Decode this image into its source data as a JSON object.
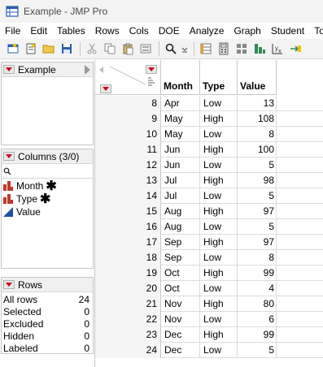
{
  "window": {
    "title": "Example - JMP Pro"
  },
  "menu": [
    "File",
    "Edit",
    "Tables",
    "Rows",
    "Cols",
    "DOE",
    "Analyze",
    "Graph",
    "Student",
    "To"
  ],
  "left": {
    "table_panel": {
      "title": "Example"
    },
    "columns_panel": {
      "title": "Columns (3/0)",
      "items": [
        {
          "label": "Month",
          "icon": "nominal-bar-icon",
          "selected_marker": "✱"
        },
        {
          "label": "Type",
          "icon": "nominal-bar-icon",
          "selected_marker": "✱"
        },
        {
          "label": "Value",
          "icon": "continuous-triangle-icon"
        }
      ]
    },
    "rows_panel": {
      "title": "Rows",
      "stats": [
        {
          "label": "All rows",
          "value": "24"
        },
        {
          "label": "Selected",
          "value": "0"
        },
        {
          "label": "Excluded",
          "value": "0"
        },
        {
          "label": "Hidden",
          "value": "0"
        },
        {
          "label": "Labeled",
          "value": "0"
        }
      ]
    }
  },
  "table": {
    "columns": [
      "Month",
      "Type",
      "Value"
    ],
    "rows": [
      {
        "n": "8",
        "month": "Apr",
        "type": "Low",
        "value": "13"
      },
      {
        "n": "9",
        "month": "May",
        "type": "High",
        "value": "108"
      },
      {
        "n": "10",
        "month": "May",
        "type": "Low",
        "value": "8"
      },
      {
        "n": "11",
        "month": "Jun",
        "type": "High",
        "value": "100"
      },
      {
        "n": "12",
        "month": "Jun",
        "type": "Low",
        "value": "5"
      },
      {
        "n": "13",
        "month": "Jul",
        "type": "High",
        "value": "98"
      },
      {
        "n": "14",
        "month": "Jul",
        "type": "Low",
        "value": "5"
      },
      {
        "n": "15",
        "month": "Aug",
        "type": "High",
        "value": "97"
      },
      {
        "n": "16",
        "month": "Aug",
        "type": "Low",
        "value": "5"
      },
      {
        "n": "17",
        "month": "Sep",
        "type": "High",
        "value": "97"
      },
      {
        "n": "18",
        "month": "Sep",
        "type": "Low",
        "value": "8"
      },
      {
        "n": "19",
        "month": "Oct",
        "type": "High",
        "value": "99"
      },
      {
        "n": "20",
        "month": "Oct",
        "type": "Low",
        "value": "4"
      },
      {
        "n": "21",
        "month": "Nov",
        "type": "High",
        "value": "80"
      },
      {
        "n": "22",
        "month": "Nov",
        "type": "Low",
        "value": "6"
      },
      {
        "n": "23",
        "month": "Dec",
        "type": "High",
        "value": "99"
      },
      {
        "n": "24",
        "month": "Dec",
        "type": "Low",
        "value": "5"
      }
    ]
  },
  "colors": {
    "red_triangle": "#d0021b",
    "nominal_icon": "#c0392b",
    "continuous_icon": "#1f4fa0"
  }
}
